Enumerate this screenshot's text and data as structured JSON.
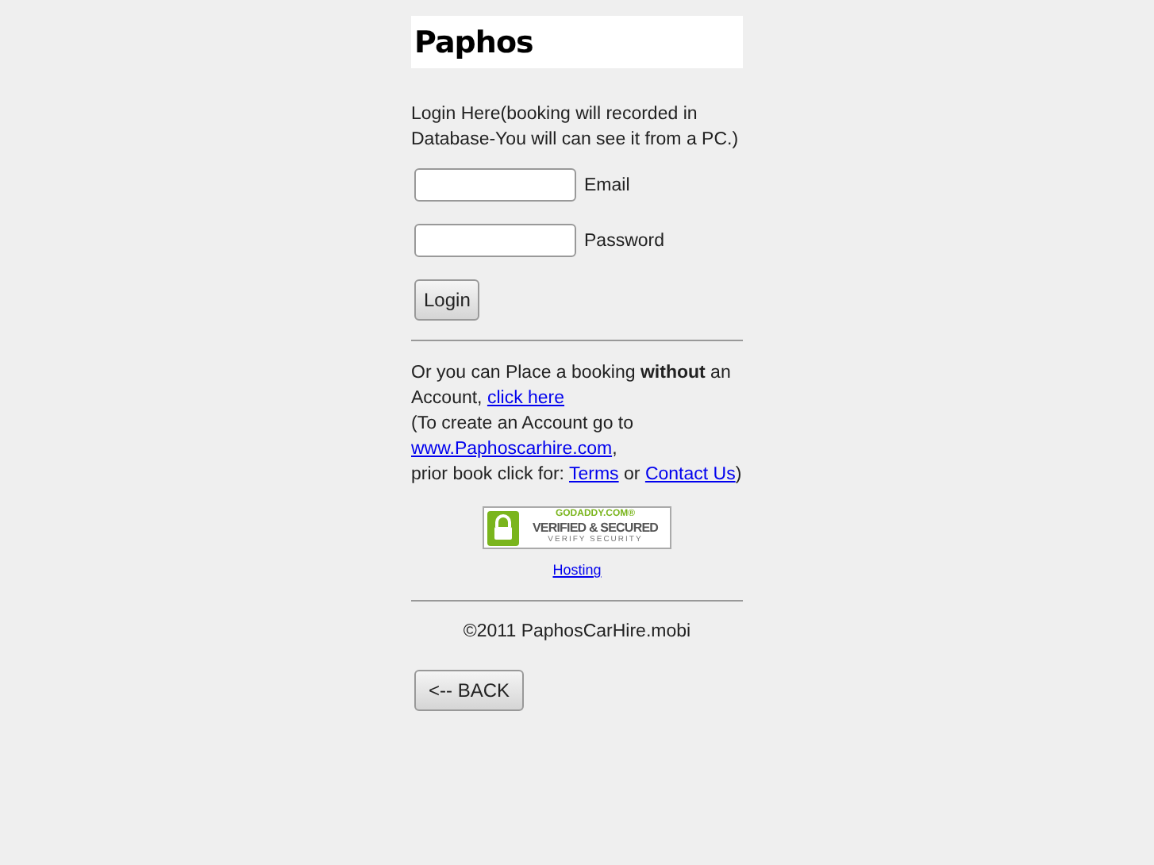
{
  "site_title": "Paphos",
  "login_intro": "Login Here(booking will recorded in Database-You will can see it from a PC.)",
  "fields": [
    {
      "label": "Email"
    },
    {
      "label": "Password"
    }
  ],
  "login_button": "Login",
  "booking_note": [
    {
      "kind": "text",
      "text": "Or you can Place a booking "
    },
    {
      "kind": "bold",
      "text": "without"
    },
    {
      "kind": "text",
      "text": " an Account, "
    },
    {
      "kind": "link",
      "text": "click here "
    },
    {
      "kind": "break"
    },
    {
      "kind": "text",
      "text": "(To create an Account go to "
    },
    {
      "kind": "link",
      "text": "www.Paphoscarhire.com"
    },
    {
      "kind": "text",
      "text": ","
    },
    {
      "kind": "break"
    },
    {
      "kind": "text",
      "text": "prior book click for: "
    },
    {
      "kind": "link",
      "text": "Terms"
    },
    {
      "kind": "text",
      "text": " or "
    },
    {
      "kind": "link",
      "text": "Contact Us"
    },
    {
      "kind": "text",
      "text": ")"
    }
  ],
  "seal": {
    "brand": "GODADDY.COM®",
    "headline": "VERIFIED & SECURED",
    "subline": "VERIFY SECURITY"
  },
  "hosting_link": "Hosting",
  "copyright": "©2011 PaphosCarHire.mobi",
  "back_button": "<-- BACK"
}
